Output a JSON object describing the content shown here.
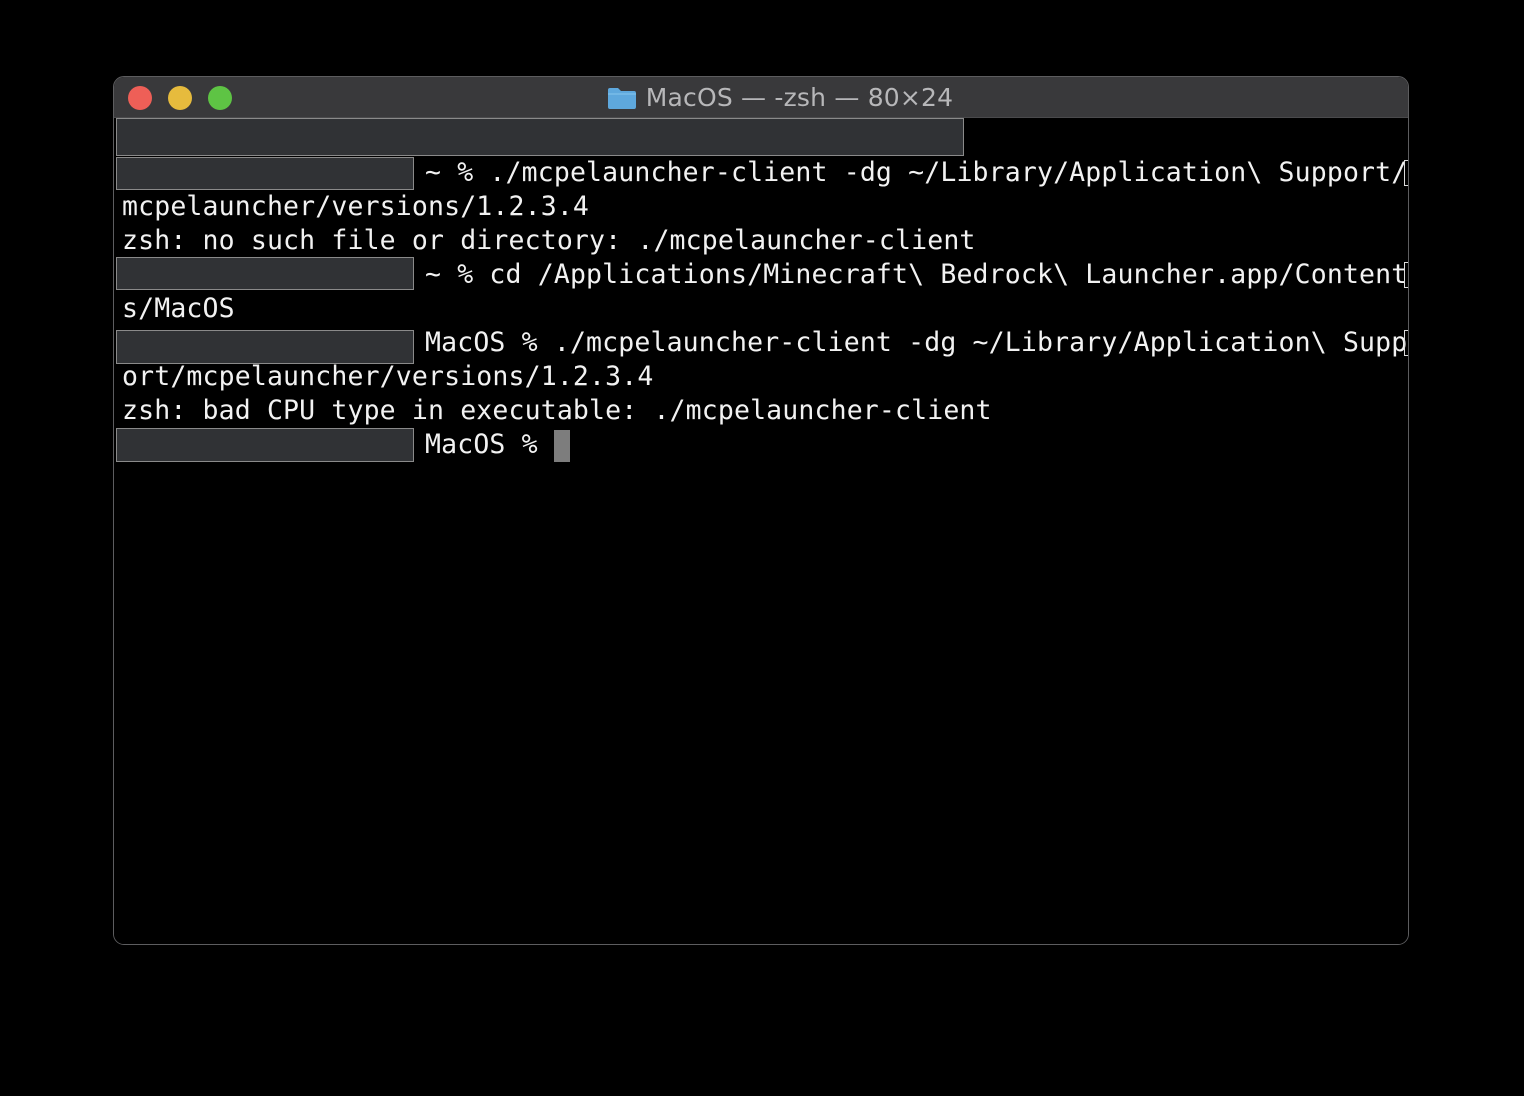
{
  "window": {
    "title": "MacOS — -zsh — 80×24",
    "traffic_lights": {
      "close_color": "#ee5f57",
      "minimize_color": "#e6bb3d",
      "zoom_color": "#5ec444"
    },
    "folder_icon": "folder-icon",
    "folder_icon_color": "#5ea8dd"
  },
  "terminal": {
    "lines": [
      "",
      "~ % ./mcpelauncher-client -dg ~/Library/Application\\ Support/",
      "mcpelauncher/versions/1.2.3.4",
      "zsh: no such file or directory: ./mcpelauncher-client",
      "~ % cd /Applications/Minecraft\\ Bedrock\\ Launcher.app/Content",
      "s/MacOS",
      "MacOS % ./mcpelauncher-client -dg ~/Library/Application\\ Supp",
      "ort/mcpelauncher/versions/1.2.3.4",
      "zsh: bad CPU type in executable: ./mcpelauncher-client",
      "MacOS %"
    ]
  }
}
